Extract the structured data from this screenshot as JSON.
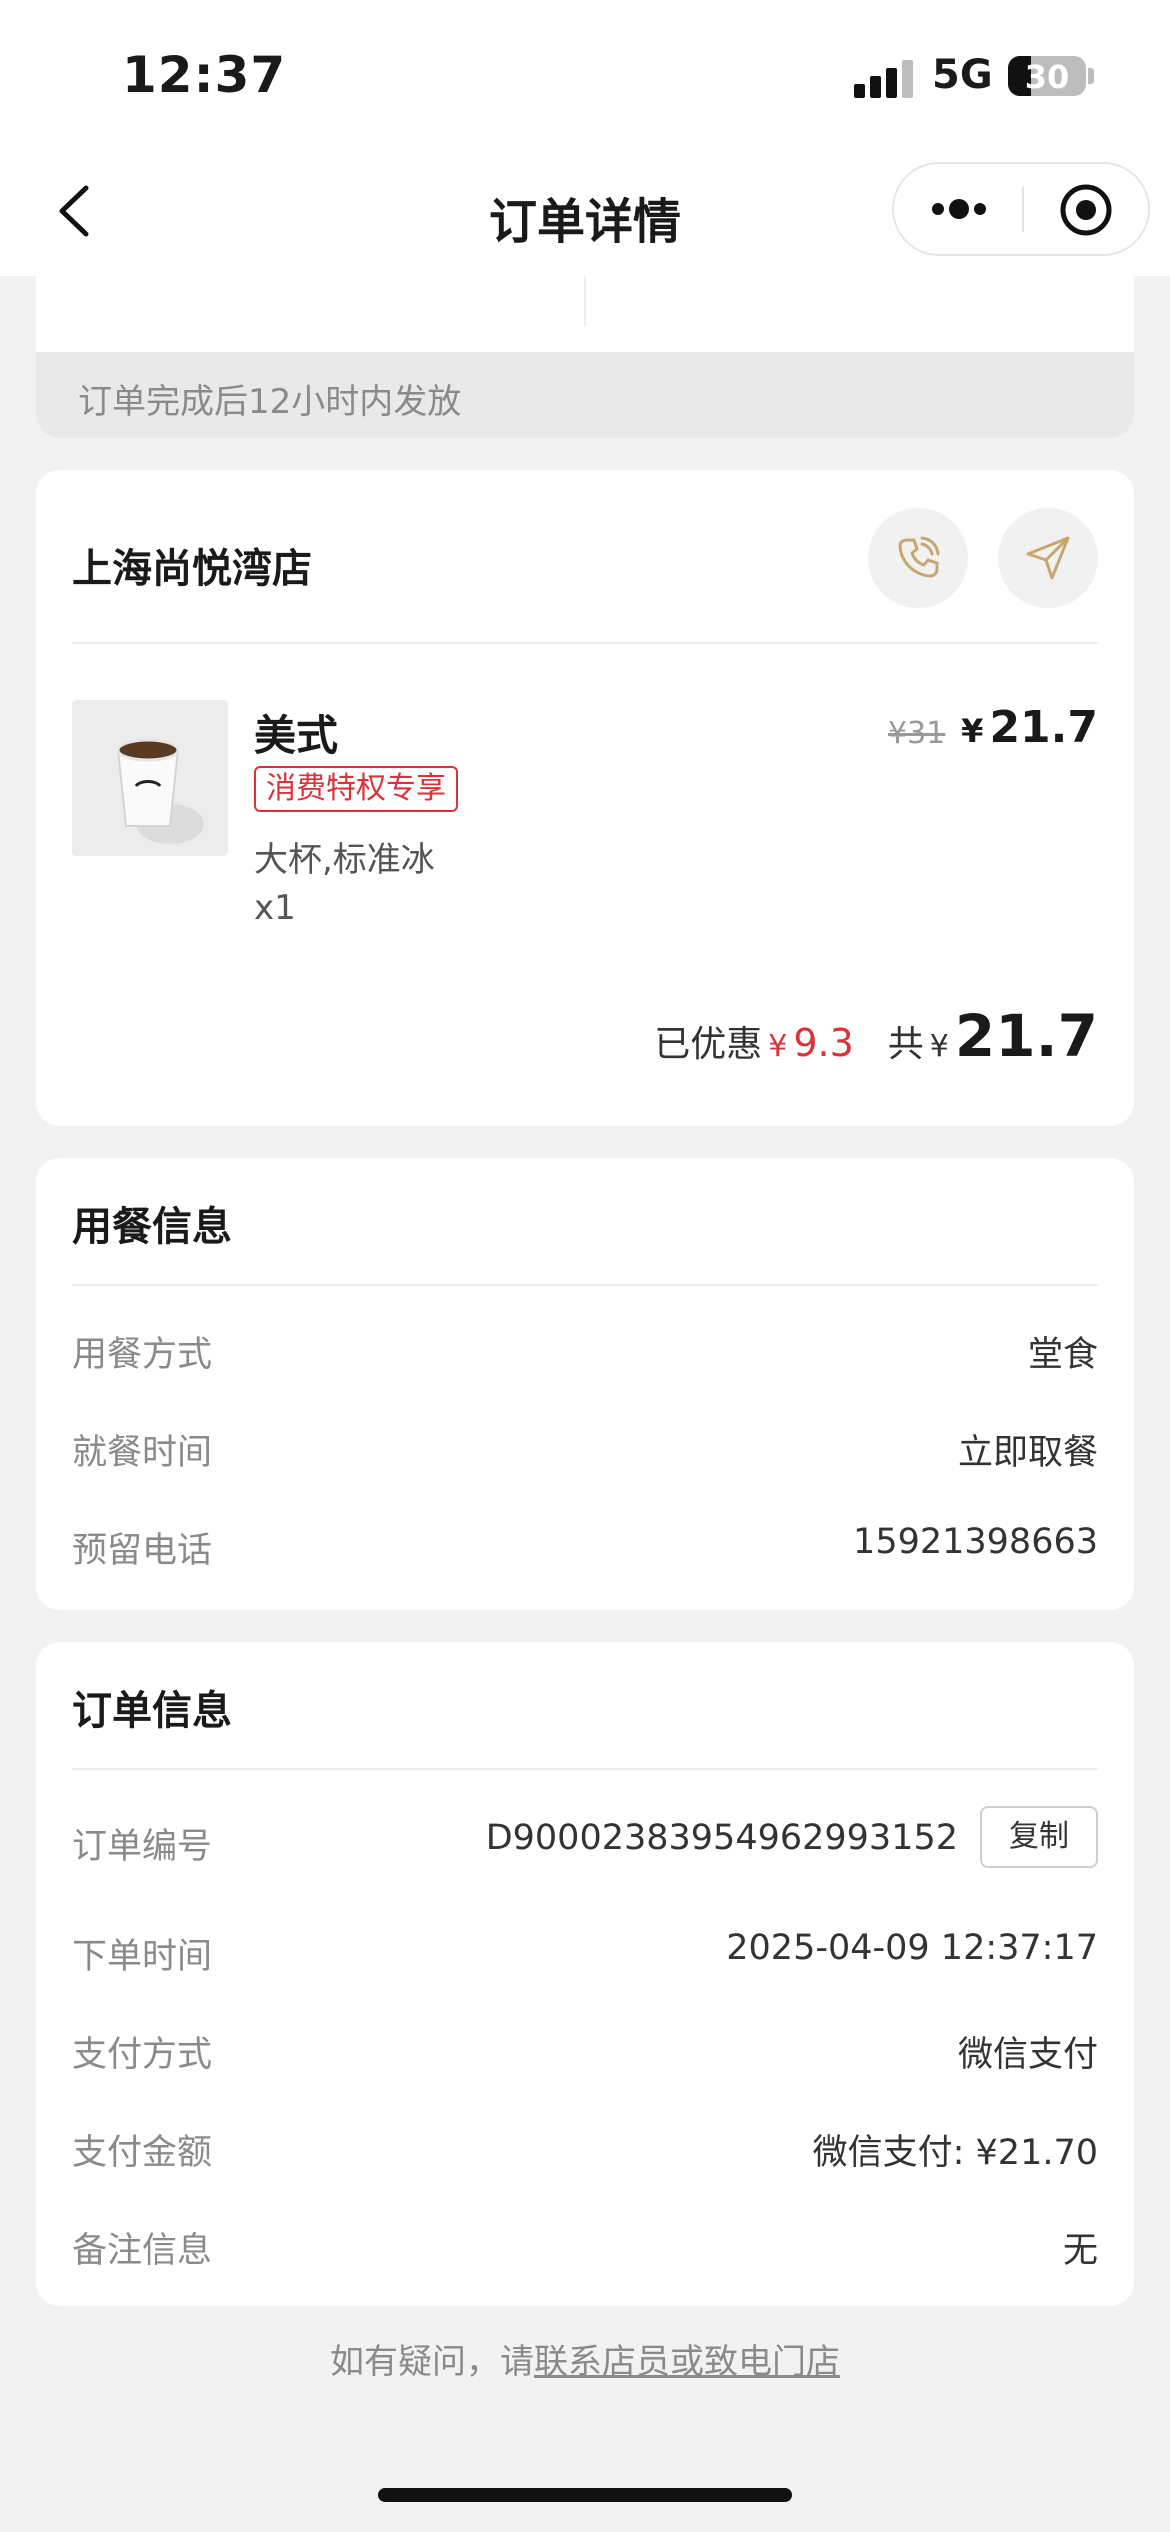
{
  "status_bar": {
    "time": "12:37",
    "network": "5G",
    "battery": "30",
    "battery_level": 0.3
  },
  "nav": {
    "title": "订单详情",
    "back_icon": "chevron-left-icon",
    "more_icon": "more-dots-icon",
    "close_icon": "target-close-icon"
  },
  "rewards": {
    "notice": "订单完成后12小时内发放"
  },
  "store": {
    "name": "上海尚悦湾店",
    "call_icon": "phone-icon",
    "nav_icon": "navigation-arrow-icon",
    "item": {
      "name": "美式",
      "badge": "消费特权专享",
      "spec": "大杯,标准冰",
      "qty": "x1",
      "original_price": "¥31",
      "currency": "¥",
      "price": "21.7"
    },
    "summary": {
      "discount_label": "已优惠",
      "discount_currency": "¥",
      "discount": "9.3",
      "total_label": "共",
      "total_currency": "¥",
      "total": "21.7"
    }
  },
  "meal_info": {
    "title": "用餐信息",
    "rows": [
      {
        "label": "用餐方式",
        "value": "堂食"
      },
      {
        "label": "就餐时间",
        "value": "立即取餐"
      },
      {
        "label": "预留电话",
        "value": "15921398663"
      }
    ]
  },
  "order_info": {
    "title": "订单信息",
    "order_no_label": "订单编号",
    "order_no": "D900023839549629931​52",
    "copy_label": "复制",
    "rows": [
      {
        "label": "下单时间",
        "value": "2025-04-09 12:37:17"
      },
      {
        "label": "支付方式",
        "value": "微信支付"
      },
      {
        "label": "支付金额",
        "value": "微信支付: ¥21.70"
      },
      {
        "label": "备注信息",
        "value": "无"
      }
    ]
  },
  "footer": {
    "prefix": "如有疑问，请",
    "link": "联系店员或致电门店"
  },
  "colors": {
    "accent_gold": "#c7a66e",
    "discount_red": "#d9333a",
    "page_bg": "#f2f2f2"
  }
}
